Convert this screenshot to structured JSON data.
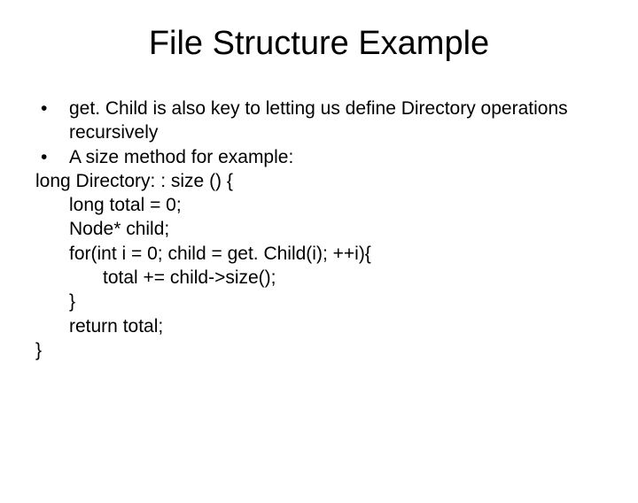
{
  "title": "File Structure Example",
  "bullets": [
    "get. Child is also key to letting us define Directory operations recursively",
    "A size method for example:"
  ],
  "code": {
    "l0": "long Directory: : size () {",
    "l1": "long total = 0;",
    "l2": "Node* child;",
    "l3": "for(int i = 0; child = get. Child(i); ++i){",
    "l4": "total += child->size();",
    "l5": "}",
    "l6": "return total;",
    "l7": "}"
  },
  "bullet_char": "•"
}
